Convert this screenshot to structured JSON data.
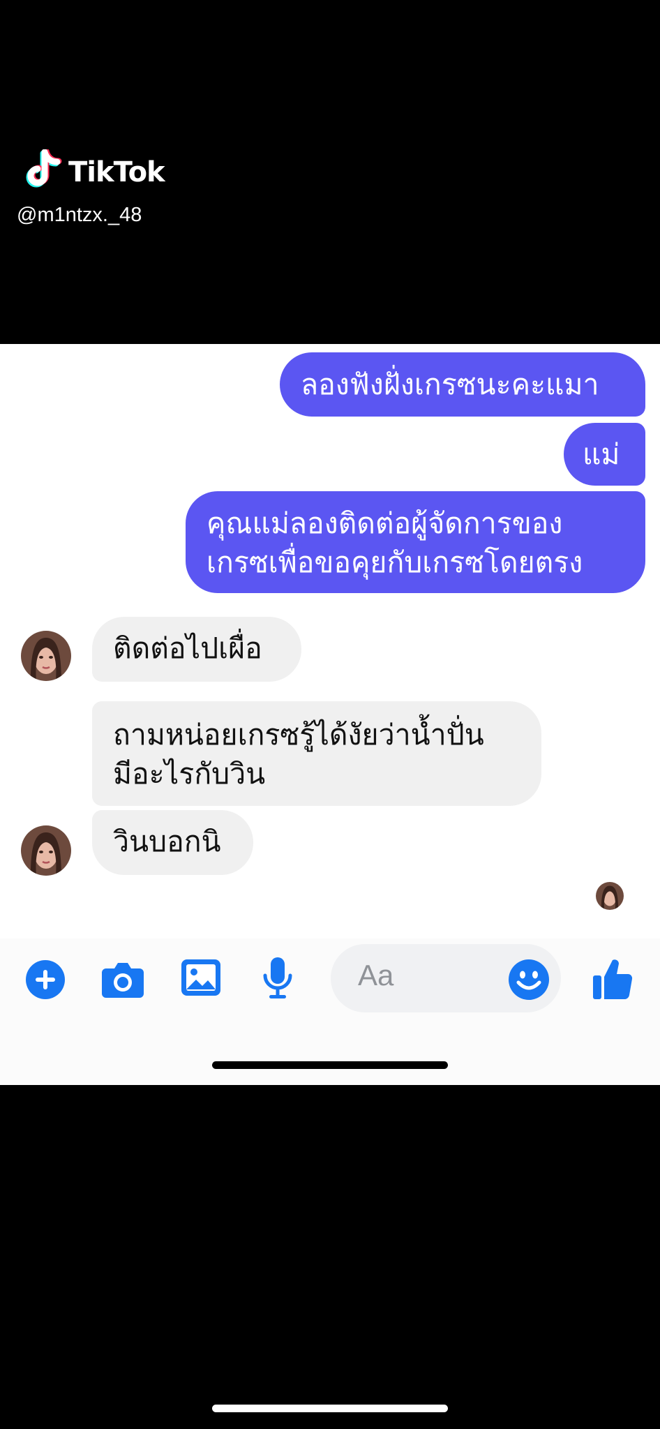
{
  "watermark": {
    "brand": "TikTok",
    "username": "@m1ntzx._48",
    "logo_icon": "tiktok-note-icon"
  },
  "conversation": {
    "accent_color": "#5b56f2",
    "incoming_color": "#f0f0f0",
    "outgoing": [
      {
        "lines": [
          "ลองฟังฝั่งเกรซนะคะแมา"
        ]
      },
      {
        "lines": [
          "แม่"
        ]
      },
      {
        "lines": [
          "คุณแม่ลองติดต่อผู้จัดการของ",
          "เกรซเพื่อขอคุยกับเกรซโดยตรง"
        ]
      }
    ],
    "incoming": [
      {
        "lines": [
          "ติดต่อไปเผื่อ"
        ]
      },
      {
        "lines": [
          "ถามหน่อยเกรซรู้ได้งัยว่าน้ำปั่น",
          "มีอะไรกับวิน"
        ]
      },
      {
        "lines": [
          "วินบอกนิ"
        ]
      }
    ]
  },
  "composer": {
    "placeholder": "Aa",
    "icons": [
      "plus-icon",
      "camera-icon",
      "image-icon",
      "mic-icon",
      "emoji-icon",
      "thumbs-up-icon"
    ],
    "icon_color": "#1877f2"
  }
}
